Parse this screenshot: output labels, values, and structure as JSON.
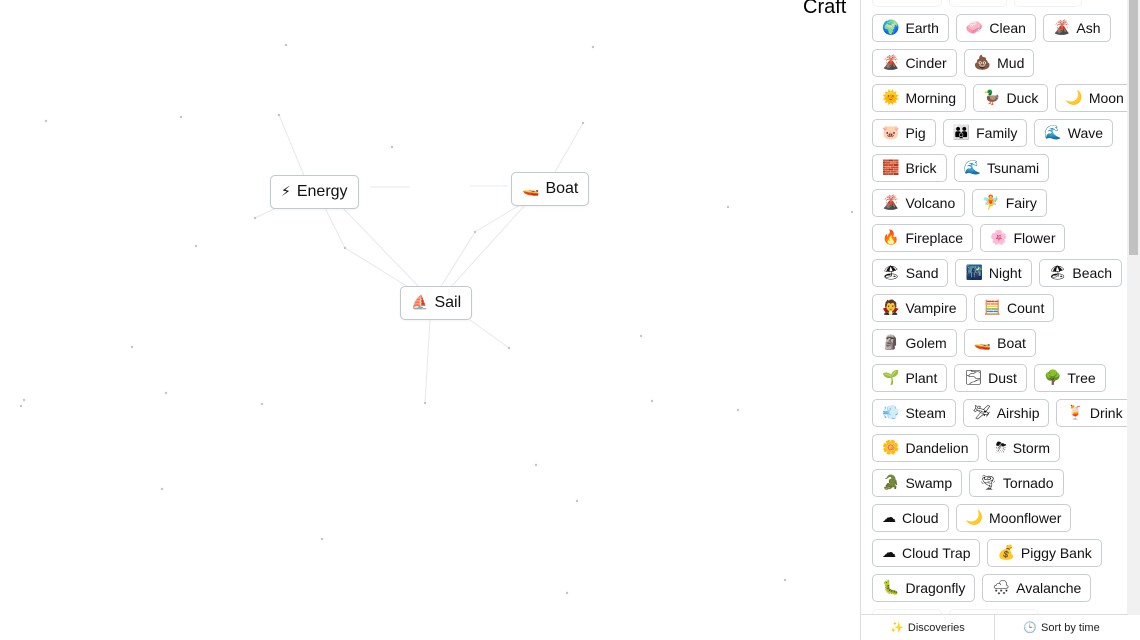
{
  "logo": "Craft",
  "canvas_items": [
    {
      "name": "Energy",
      "emoji": "⚡"
    },
    {
      "name": "Boat",
      "emoji": "🚤"
    },
    {
      "name": "Sail",
      "emoji": "⛵"
    }
  ],
  "sidebar": {
    "rows": [
      [
        {
          "name": "Earth",
          "emoji": "🌍"
        },
        {
          "name": "Clean",
          "emoji": "🧼"
        },
        {
          "name": "Ash",
          "emoji": "🌋"
        }
      ],
      [
        {
          "name": "Cinder",
          "emoji": "🌋"
        },
        {
          "name": "Mud",
          "emoji": "💩"
        }
      ],
      [
        {
          "name": "Morning",
          "emoji": "🌞"
        },
        {
          "name": "Duck",
          "emoji": "🦆"
        },
        {
          "name": "Moon",
          "emoji": "🌙"
        }
      ],
      [
        {
          "name": "Pig",
          "emoji": "🐷"
        },
        {
          "name": "Family",
          "emoji": "👪"
        },
        {
          "name": "Wave",
          "emoji": "🌊"
        }
      ],
      [
        {
          "name": "Brick",
          "emoji": "🧱"
        },
        {
          "name": "Tsunami",
          "emoji": "🌊"
        }
      ],
      [
        {
          "name": "Volcano",
          "emoji": "🌋"
        },
        {
          "name": "Fairy",
          "emoji": "🧚"
        }
      ],
      [
        {
          "name": "Fireplace",
          "emoji": "🔥"
        },
        {
          "name": "Flower",
          "emoji": "🌸"
        }
      ],
      [
        {
          "name": "Sand",
          "emoji": "🏖"
        },
        {
          "name": "Night",
          "emoji": "🌃"
        },
        {
          "name": "Beach",
          "emoji": "🏖"
        }
      ],
      [
        {
          "name": "Vampire",
          "emoji": "🧛"
        },
        {
          "name": "Count",
          "emoji": "🧮"
        }
      ],
      [
        {
          "name": "Golem",
          "emoji": "🗿"
        },
        {
          "name": "Boat",
          "emoji": "🚤"
        }
      ],
      [
        {
          "name": "Plant",
          "emoji": "🌱"
        },
        {
          "name": "Dust",
          "emoji": "🌫"
        },
        {
          "name": "Tree",
          "emoji": "🌳"
        }
      ],
      [
        {
          "name": "Steam",
          "emoji": "💨"
        },
        {
          "name": "Airship",
          "emoji": "🛩"
        },
        {
          "name": "Drink",
          "emoji": "🍹"
        }
      ],
      [
        {
          "name": "Dandelion",
          "emoji": "🌼"
        },
        {
          "name": "Storm",
          "emoji": "⛈"
        }
      ],
      [
        {
          "name": "Swamp",
          "emoji": "🐊"
        },
        {
          "name": "Tornado",
          "emoji": "🌪"
        }
      ],
      [
        {
          "name": "Cloud",
          "emoji": "☁"
        },
        {
          "name": "Moonflower",
          "emoji": "🌙"
        }
      ],
      [
        {
          "name": "Cloud Trap",
          "emoji": "☁"
        },
        {
          "name": "Piggy Bank",
          "emoji": "💰"
        }
      ],
      [
        {
          "name": "Dragonfly",
          "emoji": "🐛"
        },
        {
          "name": "Avalanche",
          "emoji": "🌨"
        }
      ]
    ],
    "footer": {
      "discoveries": "Discoveries",
      "sort": "Sort by time"
    }
  }
}
